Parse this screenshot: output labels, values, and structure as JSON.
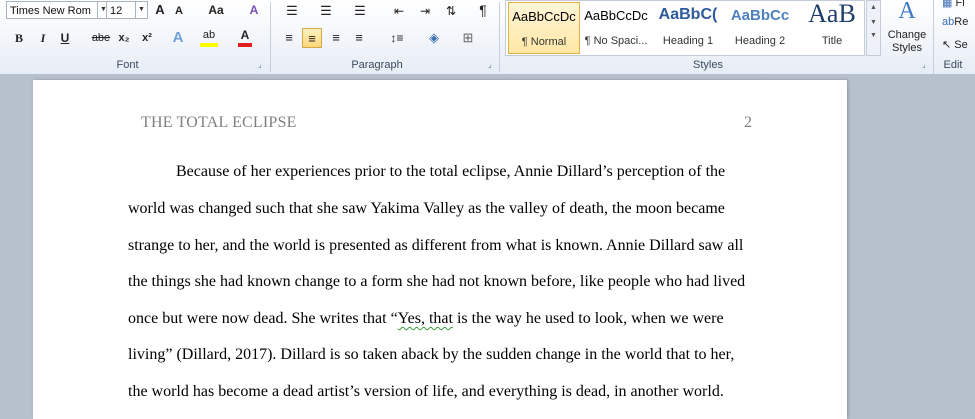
{
  "ribbon": {
    "font": {
      "label": "Font",
      "font_name": "Times New Rom",
      "font_size": "12",
      "grow_label": "A",
      "shrink_label": "A",
      "case_label": "Aa",
      "clear_label": "A",
      "bold": "B",
      "italic": "I",
      "underline": "U",
      "strike": "abe",
      "subscript": "x₂",
      "superscript": "x²",
      "effects": "A",
      "highlight": "ab",
      "color": "A"
    },
    "paragraph": {
      "label": "Paragraph",
      "pilcrow": "¶"
    },
    "styles": {
      "label": "Styles",
      "items": [
        {
          "preview": "AaBbCcDc",
          "name": "¶ Normal"
        },
        {
          "preview": "AaBbCcDc",
          "name": "¶ No Spaci..."
        },
        {
          "preview": "AaBbC(",
          "name": "Heading 1"
        },
        {
          "preview": "AaBbCc",
          "name": "Heading 2"
        },
        {
          "preview": "AaB",
          "name": "Title"
        }
      ],
      "change_styles_line1": "Change",
      "change_styles_line2": "Styles",
      "change_styles_icon": "A"
    },
    "editing": {
      "label": "Edit",
      "find": "Fi",
      "replace": "Re",
      "select": "Se"
    }
  },
  "document": {
    "header_title": "THE TOTAL ECLIPSE",
    "page_number": "2",
    "lines": [
      "Because of her experiences prior to the total eclipse,  Annie Dillard’s perception of the",
      "world was changed such that she saw Yakima  Valley as the valley  of death, the moon became",
      "strange to her, and the world is presented as different from what is known. Annie Dillard  saw all",
      "the things she had known change to a form she had not known before, like people  who had lived",
      "once but were now dead. She writes that “",
      "Yes, that",
      " is the way he used to look, when we were",
      "living” (Dillard, 2017).  Dillard is so taken aback by the sudden change in the world that to her,",
      "the world has become  a dead artist’s version  of life, and everything is  dead, in another world."
    ]
  }
}
